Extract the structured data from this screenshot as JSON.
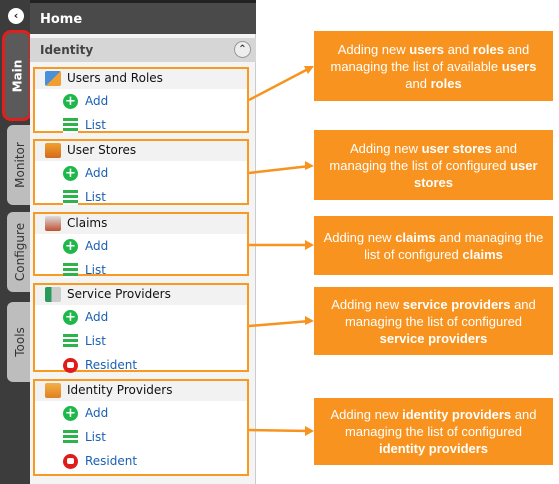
{
  "nav": {
    "back_icon": "chevron-left-icon",
    "tabs": [
      "Main",
      "Monitor",
      "Configure",
      "Tools"
    ],
    "active_tab": "Main"
  },
  "header": {
    "title": "Home"
  },
  "section": {
    "title": "Identity"
  },
  "groups": [
    {
      "title": "Users and Roles",
      "items": [
        "Add",
        "List"
      ]
    },
    {
      "title": "User Stores",
      "items": [
        "Add",
        "List"
      ]
    },
    {
      "title": "Claims",
      "items": [
        "Add",
        "List"
      ]
    },
    {
      "title": "Service Providers",
      "items": [
        "Add",
        "List",
        "Resident"
      ]
    },
    {
      "title": "Identity Providers",
      "items": [
        "Add",
        "List",
        "Resident"
      ]
    }
  ],
  "callouts": [
    {
      "parts": [
        "Adding new ",
        "users",
        " and ",
        "roles",
        " and managing the list of available ",
        "users",
        " and ",
        "roles"
      ]
    },
    {
      "parts": [
        "Adding new ",
        "user stores",
        " and managing the list of configured ",
        "user stores",
        ""
      ]
    },
    {
      "parts": [
        "Adding new ",
        "claims",
        " and managing the list of configured ",
        "claims",
        ""
      ]
    },
    {
      "parts": [
        "Adding new ",
        "service providers",
        " and managing the list of configured ",
        "service providers",
        ""
      ]
    },
    {
      "parts": [
        "Adding new ",
        "identity providers",
        " and managing the list of configured ",
        "identity providers",
        ""
      ]
    }
  ],
  "colors": {
    "accent": "#f7931e",
    "active_outline": "#e0201c",
    "link": "#1a5fb4"
  }
}
